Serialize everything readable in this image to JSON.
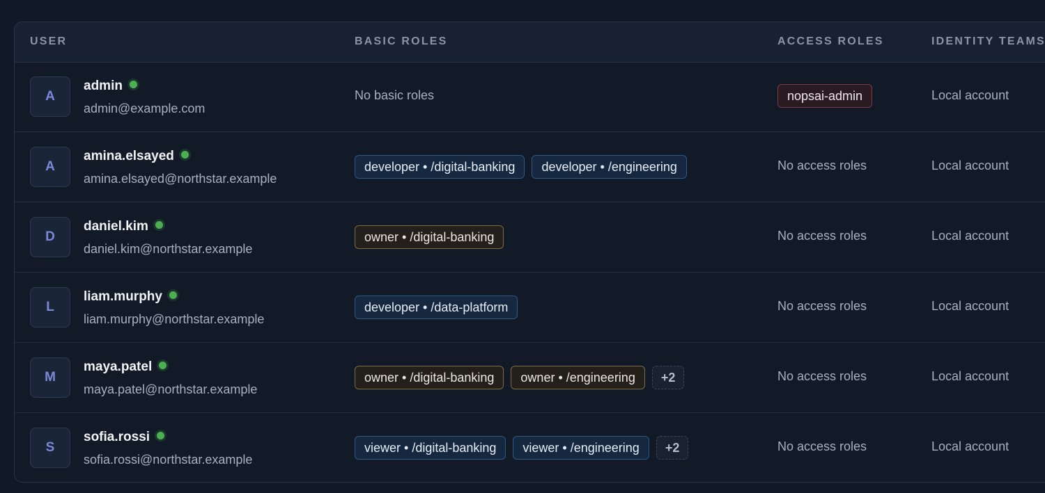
{
  "headers": {
    "user": "USER",
    "basic_roles": "BASIC ROLES",
    "access_roles": "ACCESS ROLES",
    "identity_teams": "IDENTITY TEAMS"
  },
  "colors": {
    "online": "#4caf50",
    "avatar_text": "#7d88d8",
    "role_blue_border": "#2f5785",
    "role_gold_border": "#806a46",
    "access_red_border": "#7c3b44"
  },
  "rows": [
    {
      "initial": "A",
      "username": "admin",
      "email": "admin@example.com",
      "basic_roles_text": "No basic roles",
      "basic_roles": [],
      "access_role": "nopsai-admin",
      "access_text": "",
      "team": "Local account"
    },
    {
      "initial": "A",
      "username": "amina.elsayed",
      "email": "amina.elsayed@northstar.example",
      "basic_roles": [
        {
          "label": "developer • /digital-banking",
          "color": "blue"
        },
        {
          "label": "developer • /engineering",
          "color": "blue"
        }
      ],
      "access_text": "No access roles",
      "team": "Local account"
    },
    {
      "initial": "D",
      "username": "daniel.kim",
      "email": "daniel.kim@northstar.example",
      "basic_roles": [
        {
          "label": "owner • /digital-banking",
          "color": "gold"
        }
      ],
      "access_text": "No access roles",
      "team": "Local account"
    },
    {
      "initial": "L",
      "username": "liam.murphy",
      "email": "liam.murphy@northstar.example",
      "basic_roles": [
        {
          "label": "developer • /data-platform",
          "color": "blue"
        }
      ],
      "access_text": "No access roles",
      "team": "Local account"
    },
    {
      "initial": "M",
      "username": "maya.patel",
      "email": "maya.patel@northstar.example",
      "basic_roles": [
        {
          "label": "owner • /digital-banking",
          "color": "gold"
        },
        {
          "label": "owner • /engineering",
          "color": "gold"
        }
      ],
      "more": "+2",
      "access_text": "No access roles",
      "team": "Local account"
    },
    {
      "initial": "S",
      "username": "sofia.rossi",
      "email": "sofia.rossi@northstar.example",
      "basic_roles": [
        {
          "label": "viewer • /digital-banking",
          "color": "blue"
        },
        {
          "label": "viewer • /engineering",
          "color": "blue"
        }
      ],
      "more": "+2",
      "access_text": "No access roles",
      "team": "Local account"
    }
  ]
}
